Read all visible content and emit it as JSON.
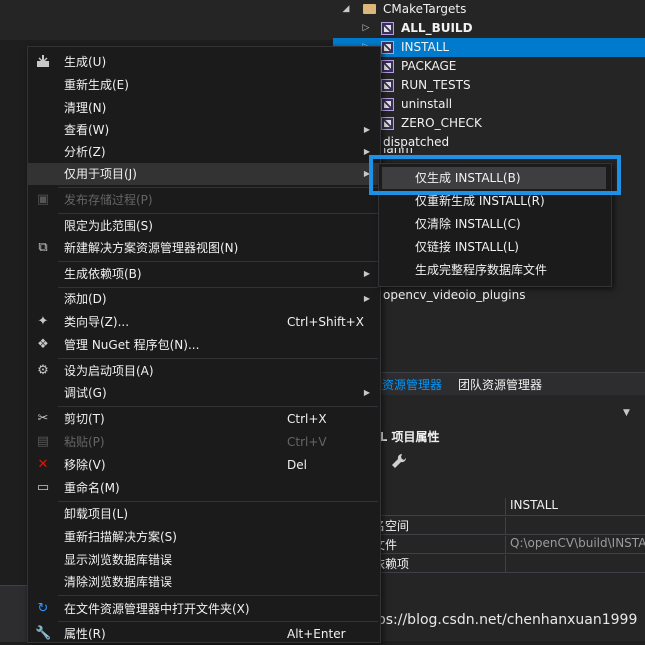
{
  "tree": {
    "folder": "CMakeTargets",
    "items": [
      {
        "label": "ALL_BUILD",
        "bold": true
      },
      {
        "label": "INSTALL",
        "selected": true
      },
      {
        "label": "PACKAGE"
      },
      {
        "label": "RUN_TESTS"
      },
      {
        "label": "uninstall"
      },
      {
        "label": "ZERO_CHECK"
      }
    ],
    "dispatched": "dispatched",
    "partial_hidden": "ianm",
    "opencv_item": "opencv_videoio_plugins"
  },
  "tabs": {
    "active": "案资源管理器",
    "team": "团队资源管理器"
  },
  "properties": {
    "title": "LL 项目属性",
    "rows": [
      {
        "name": ")",
        "value": "INSTALL",
        "grey": false
      },
      {
        "name": "名空间",
        "value": "",
        "grey": false
      },
      {
        "name": "文件",
        "value": "Q:\\openCV\\build\\INSTAL",
        "grey": true
      },
      {
        "name": "依赖项",
        "value": "",
        "grey": false
      }
    ]
  },
  "context_menu": {
    "items": [
      {
        "label": "生成(U)",
        "icon": "build-icon"
      },
      {
        "label": "重新生成(E)"
      },
      {
        "label": "清理(N)"
      },
      {
        "label": "查看(W)",
        "submenu": true
      },
      {
        "label": "分析(Z)",
        "submenu": true
      },
      {
        "label": "仅用于项目(J)",
        "submenu": true,
        "highlighted": true
      },
      {
        "label": "发布存储过程(P)",
        "disabled": true,
        "icon": "publish-icon"
      },
      {
        "label": "限定为此范围(S)"
      },
      {
        "label": "新建解决方案资源管理器视图(N)",
        "icon": "new-view-icon"
      },
      {
        "label": "生成依赖项(B)",
        "submenu": true
      },
      {
        "label": "添加(D)",
        "submenu": true
      },
      {
        "label": "类向导(Z)...",
        "shortcut": "Ctrl+Shift+X",
        "icon": "class-wizard-icon"
      },
      {
        "label": "管理 NuGet 程序包(N)...",
        "icon": "nuget-icon"
      },
      {
        "label": "设为启动项目(A)",
        "icon": "gear-icon"
      },
      {
        "label": "调试(G)",
        "submenu": true
      },
      {
        "label": "剪切(T)",
        "shortcut": "Ctrl+X",
        "icon": "scissors-icon"
      },
      {
        "label": "粘贴(P)",
        "shortcut": "Ctrl+V",
        "disabled": true,
        "icon": "paste-icon"
      },
      {
        "label": "移除(V)",
        "shortcut": "Del",
        "icon": "remove-icon"
      },
      {
        "label": "重命名(M)",
        "icon": "rename-icon"
      },
      {
        "label": "卸载项目(L)"
      },
      {
        "label": "重新扫描解决方案(S)"
      },
      {
        "label": "显示浏览数据库错误"
      },
      {
        "label": "清除浏览数据库错误"
      },
      {
        "label": "在文件资源管理器中打开文件夹(X)",
        "icon": "open-folder-icon"
      },
      {
        "label": "属性(R)",
        "shortcut": "Alt+Enter",
        "icon": "wrench-icon"
      }
    ]
  },
  "submenu": {
    "items": [
      {
        "label": "仅生成 INSTALL(B)",
        "highlighted": true
      },
      {
        "label": "仅重新生成 INSTALL(R)"
      },
      {
        "label": "仅清除 INSTALL(C)"
      },
      {
        "label": "仅链接 INSTALL(L)"
      },
      {
        "label": "生成完整程序数据库文件"
      }
    ]
  },
  "watermark": "https://blog.csdn.net/chenhanxuan1999",
  "colors": {
    "accent": "#007acc",
    "highlight_box": "#1e90e6",
    "menu_bg": "#1b1b1c"
  }
}
